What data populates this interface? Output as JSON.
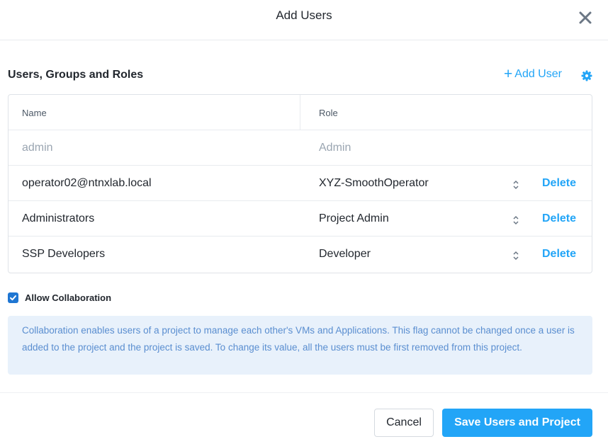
{
  "dialog": {
    "title": "Add Users",
    "close_icon": "close-icon"
  },
  "section": {
    "title": "Users, Groups and Roles",
    "add_user_label": "Add User",
    "add_user_icon": "plus-icon",
    "settings_icon": "gear-icon"
  },
  "table": {
    "columns": [
      "Name",
      "Role"
    ],
    "rows": [
      {
        "name": "admin",
        "role": "Admin",
        "muted": true
      },
      {
        "name": "operator02@ntnxlab.local",
        "role": "XYZ-SmoothOperator",
        "delete_label": "Delete"
      },
      {
        "name": "Administrators",
        "role": "Project Admin",
        "delete_label": "Delete"
      },
      {
        "name": "SSP Developers",
        "role": "Developer",
        "delete_label": "Delete"
      }
    ]
  },
  "collaboration": {
    "checked": true,
    "label": "Allow Collaboration",
    "info": "Collaboration enables users of a project to manage each other's VMs and Applications. This flag cannot be changed once a user is added to the project and the project is saved. To change its value, all the users must be first removed from this project."
  },
  "footer": {
    "cancel_label": "Cancel",
    "save_label": "Save Users and Project"
  },
  "colors": {
    "accent": "#22a5f7",
    "checkbox": "#1f76d2",
    "info_bg": "#e8f1fb",
    "info_text": "#5a8ed0"
  }
}
